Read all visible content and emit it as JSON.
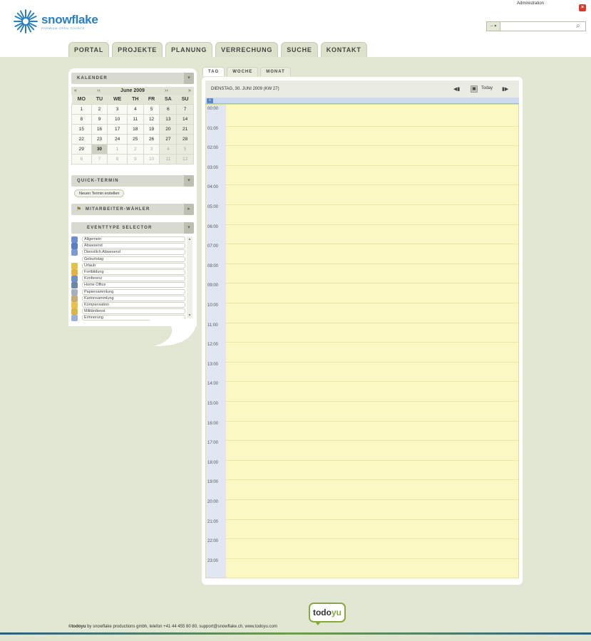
{
  "header": {
    "brand": "snowflake",
    "brand_tagline": "PREMIUM OPEN SOURCE",
    "admin_link": "Administration",
    "search": {
      "select_value": "-- ▾",
      "value": ""
    }
  },
  "nav": {
    "tabs": [
      "PORTAL",
      "PROJEKTE",
      "PLANUNG",
      "VERRECHUNG",
      "SUCHE",
      "KONTAKT"
    ],
    "active_index": 2
  },
  "calendar": {
    "title": "KALENDER",
    "toggle": "▾",
    "prev_year": "«",
    "prev_month": "‹‹",
    "month_label": "June 2009",
    "next_month": "››",
    "next_year": "»",
    "weekdays": [
      "MO",
      "TU",
      "WE",
      "TH",
      "FR",
      "SA",
      "SU"
    ],
    "weeks": [
      [
        "1",
        "2",
        "3",
        "4",
        "5",
        "6",
        "7"
      ],
      [
        "8",
        "9",
        "10",
        "11",
        "12",
        "13",
        "14"
      ],
      [
        "15",
        "16",
        "17",
        "18",
        "19",
        "20",
        "21"
      ],
      [
        "22",
        "23",
        "24",
        "25",
        "26",
        "27",
        "28"
      ],
      [
        "29",
        "30",
        "1",
        "2",
        "3",
        "4",
        "5"
      ],
      [
        "6",
        "7",
        "8",
        "9",
        "10",
        "11",
        "12"
      ]
    ],
    "today_label": "30"
  },
  "quick": {
    "title": "QUICK-TERMIN",
    "toggle": "▾",
    "button": "Neuen Termin erstellen"
  },
  "staff": {
    "title": "MITARBEITER-WÄHLER",
    "toggle": "▸"
  },
  "eventtypes": {
    "title": "EVENTTYPE SELECTOR",
    "toggle": "▾",
    "items": [
      {
        "label": "Allgemein",
        "color": "#6b8fd0"
      },
      {
        "label": "Abwesend",
        "color": "#5a7fc2"
      },
      {
        "label": "Dienstlich Abwesend",
        "color": "#7d9bd1"
      },
      {
        "label": "Geburtstag",
        "color": ""
      },
      {
        "label": "Urlaub",
        "color": "#e3c24a"
      },
      {
        "label": "Fortbildung",
        "color": "#e2b33f"
      },
      {
        "label": "Konferenz",
        "color": "#6e8fca"
      },
      {
        "label": "Home Office",
        "color": "#6f86a8"
      },
      {
        "label": "Papiersammlung",
        "color": "#a7b0bd"
      },
      {
        "label": "Kartonsammlung",
        "color": "#c6ad6f"
      },
      {
        "label": "Kompensation",
        "color": "#e8c04a"
      },
      {
        "label": "Militärdienst",
        "color": "#d8b64a"
      },
      {
        "label": "Erinnerung",
        "color": "#9db0d6"
      }
    ]
  },
  "view_tabs": [
    "TAG",
    "WOCHE",
    "MONAT"
  ],
  "day_view": {
    "date_label": "DIENSTAG, 30. JUNI 2009 (KW 27)",
    "today_label": "Today",
    "hours": [
      "00:00",
      "01:00",
      "02:00",
      "03:00",
      "04:00",
      "05:00",
      "06:00",
      "07:00",
      "08:00",
      "09:00",
      "10:00",
      "11:00",
      "12:00",
      "13:00",
      "14:00",
      "15:00",
      "16:00",
      "17:00",
      "18:00",
      "19:00",
      "20:00",
      "21:00",
      "22:00",
      "23:00"
    ]
  },
  "footer": {
    "logo_a": "todo",
    "logo_b": "yu",
    "brand": "©todoyu",
    "text": " by snowflake productions gmbh, telefon +41 44 455 80 80, support@snowflake.ch, www.todoyu.com"
  },
  "colors": {
    "background": "#e2e7d3",
    "brand_blue": "#2a7fc1",
    "grid_yellow": "#fcf8c4",
    "accent_green": "#8aa842"
  }
}
